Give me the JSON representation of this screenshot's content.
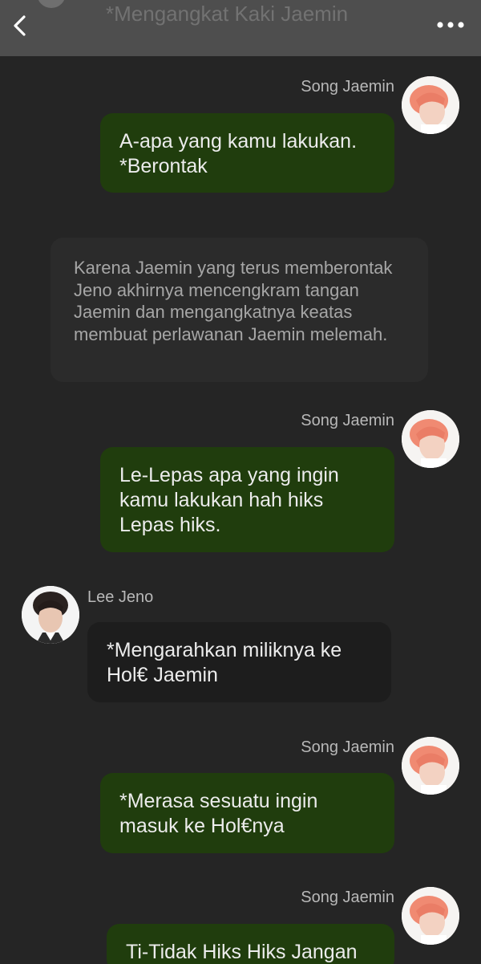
{
  "header": {
    "title": "*Mengangkat Kaki Jaemin"
  },
  "colors": {
    "background": "#252525",
    "header": "#4e4e4e",
    "my_bubble": "#203d0d",
    "their_bubble": "#1d1d1d",
    "narration_bubble": "#2b2b2b",
    "jaemin_hair": "#f08a72"
  },
  "messages": [
    {
      "sender": "Song Jaemin",
      "text": "A-apa yang kamu lakukan.\n*Berontak"
    },
    {
      "narration": "Karena Jaemin yang terus memberontak Jeno akhirnya mencengkram tangan Jaemin dan mengangkatnya keatas membuat perlawanan Jaemin melemah."
    },
    {
      "sender": "Song Jaemin",
      "text": "Le-Lepas apa yang ingin kamu lakukan hah hiks Lepas hiks."
    },
    {
      "sender": "Lee Jeno",
      "text": "*Mengarahkan miliknya ke Hol€ Jaemin"
    },
    {
      "sender": "Song Jaemin",
      "text": "*Merasa sesuatu ingin masuk ke Hol€nya"
    },
    {
      "sender": "Song Jaemin",
      "text": "Ti-Tidak Hiks Hiks Jangan"
    }
  ]
}
